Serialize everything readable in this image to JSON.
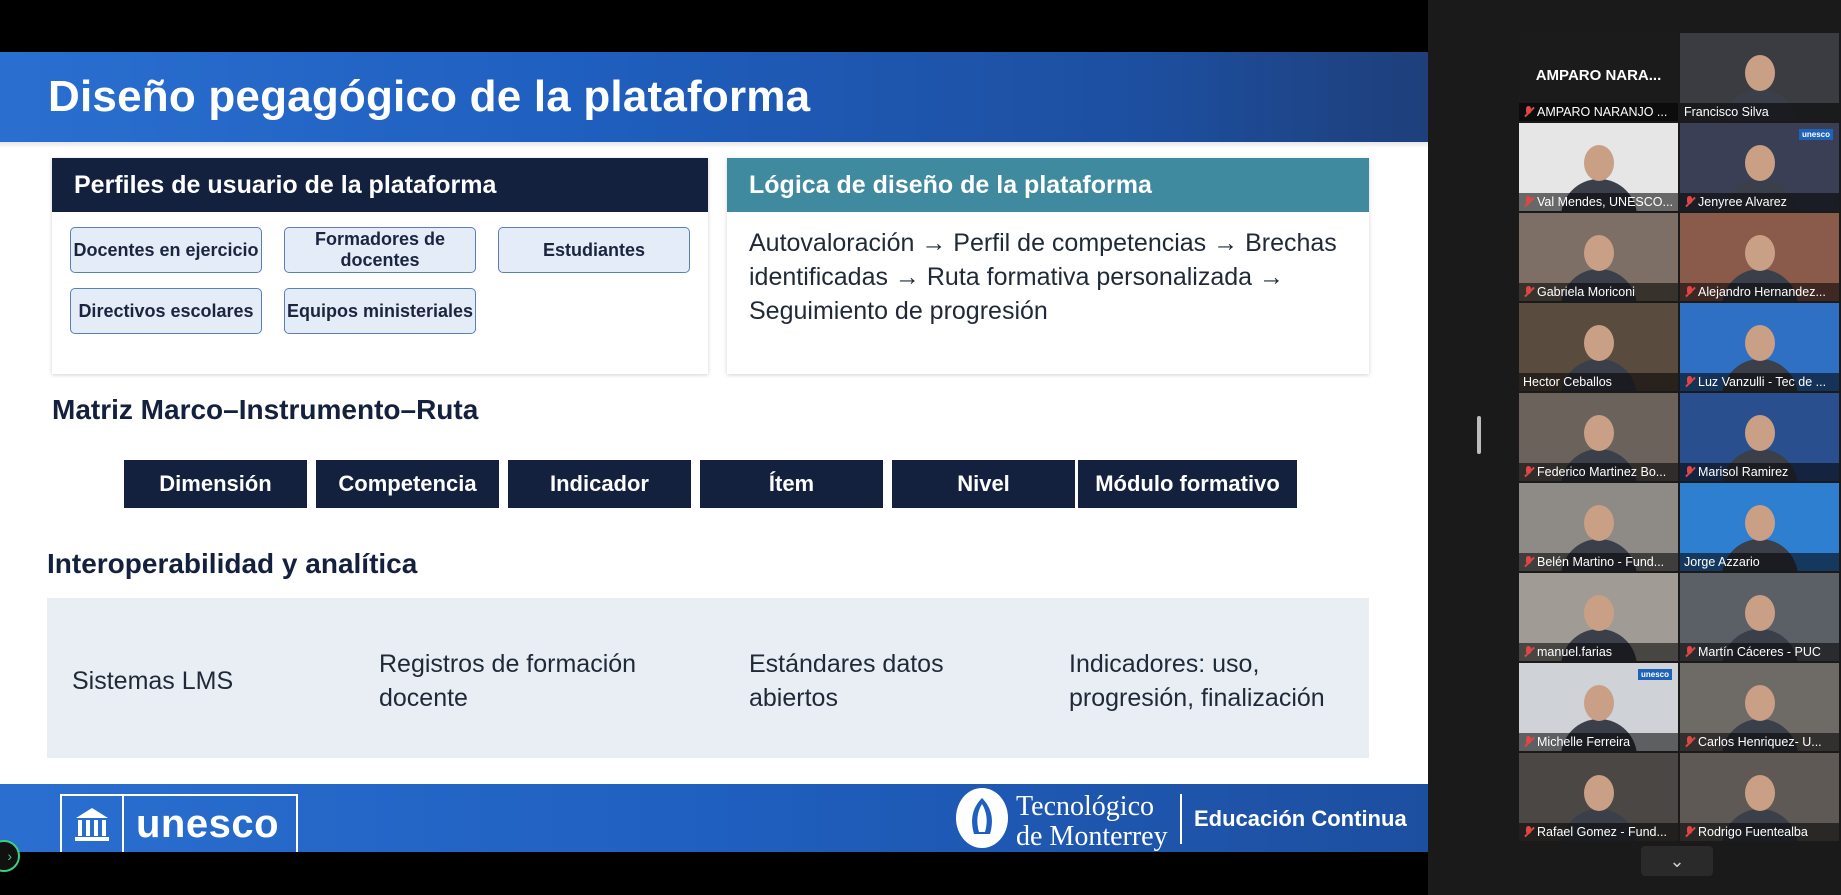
{
  "slide": {
    "title": "Diseño pegagógico de la plataforma",
    "profiles": {
      "heading": "Perfiles de usuario de la plataforma",
      "chips": [
        "Docentes en ejercicio",
        "Formadores de docentes",
        "Estudiantes",
        "Directivos escolares",
        "Equipos ministeriales"
      ]
    },
    "logic": {
      "heading": "Lógica de diseño de la plataforma",
      "text": "Autovaloración → Perfil de competencias → Brechas identificadas → Ruta formativa personalizada → Seguimiento de progresión"
    },
    "matrix": {
      "title": "Matriz Marco–Instrumento–Ruta",
      "boxes": [
        "Dimensión",
        "Competencia",
        "Indicador",
        "Ítem",
        "Nivel",
        "Módulo formativo"
      ]
    },
    "interop": {
      "title": "Interoperabilidad y analítica",
      "items": [
        "Sistemas LMS",
        "Registros de formación docente",
        "Estándares datos abiertos",
        "Indicadores: uso, progresión, finalización"
      ]
    },
    "footer": {
      "unesco": "unesco",
      "tec_name_line1": "Tecnológico",
      "tec_name_line2": "de Monterrey",
      "edu": "Educación Continua"
    }
  },
  "participants": {
    "tiles": [
      {
        "name": "AMPARO NARANJO ...",
        "big_label": "AMPARO NARA...",
        "muted": true
      },
      {
        "name": "Francisco Silva",
        "muted": false
      },
      {
        "name": "Val Mendes, UNESCO...",
        "muted": true
      },
      {
        "name": "Jenyree Alvarez",
        "muted": true,
        "brand": "unesco"
      },
      {
        "name": "Gabriela Moriconi",
        "muted": true
      },
      {
        "name": "Alejandro Hernandez...",
        "muted": true
      },
      {
        "name": "Hector Ceballos",
        "muted": false,
        "active": true
      },
      {
        "name": "Luz Vanzulli - Tec de ...",
        "muted": true
      },
      {
        "name": "Federico Martinez Bo...",
        "muted": true
      },
      {
        "name": "Marisol Ramirez",
        "muted": true
      },
      {
        "name": "Belén Martino - Fund...",
        "muted": true
      },
      {
        "name": "Jorge Azzario",
        "muted": false
      },
      {
        "name": "manuel.farias",
        "muted": true
      },
      {
        "name": "Martín Cáceres - PUC",
        "muted": true
      },
      {
        "name": "Michelle Ferreira",
        "muted": true,
        "brand": "unesco"
      },
      {
        "name": "Carlos Henriquez- U...",
        "muted": true
      },
      {
        "name": "Rafael Gomez - Fund...",
        "muted": true
      },
      {
        "name": "Rodrigo Fuentealba",
        "muted": true
      }
    ]
  },
  "colors": {
    "navy": "#13203e",
    "teal": "#3f8a9f",
    "blue": "#1f5fbf",
    "muted": "#e04646",
    "active": "#43c26e"
  }
}
